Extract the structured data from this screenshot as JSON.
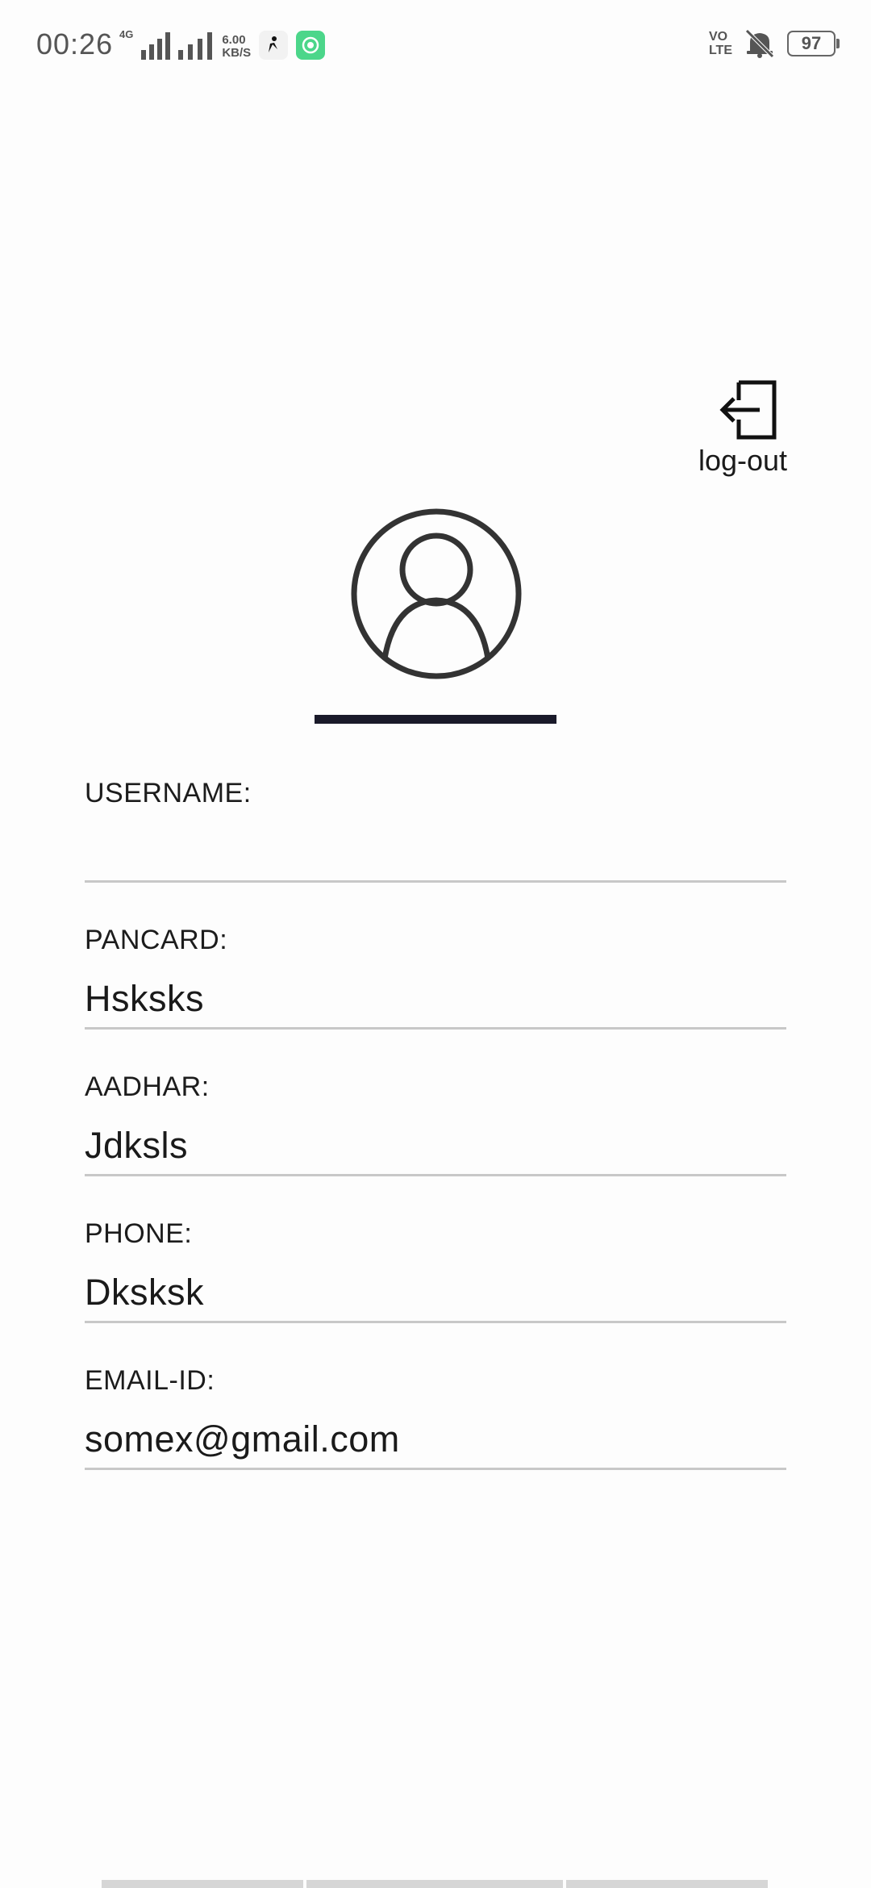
{
  "status_bar": {
    "time": "00:26",
    "network_label": "4G",
    "speed_value": "6.00",
    "speed_unit": "KB/S",
    "volte_top": "VO",
    "volte_bottom": "LTE",
    "battery": "97",
    "icons": [
      "signal-icon",
      "signal-icon",
      "app-notification-icon",
      "app-notification-icon",
      "volte-icon",
      "mute-icon",
      "battery-icon"
    ]
  },
  "header": {
    "logout_label": "log-out",
    "logout_icon": "logout-icon"
  },
  "profile": {
    "avatar_icon": "user-circle-icon"
  },
  "fields": [
    {
      "label": "USERNAME:",
      "value": ""
    },
    {
      "label": "PANCARD:",
      "value": "Hsksks"
    },
    {
      "label": "AADHAR:",
      "value": "Jdksls"
    },
    {
      "label": "PHONE:",
      "value": "Dksksk"
    },
    {
      "label": "EMAIL-ID:",
      "value": "somex@gmail.com"
    }
  ],
  "colors": {
    "background": "#fdfdfd",
    "text": "#1a1a1a",
    "underline": "#c8c8c8",
    "icon": "#333333"
  }
}
